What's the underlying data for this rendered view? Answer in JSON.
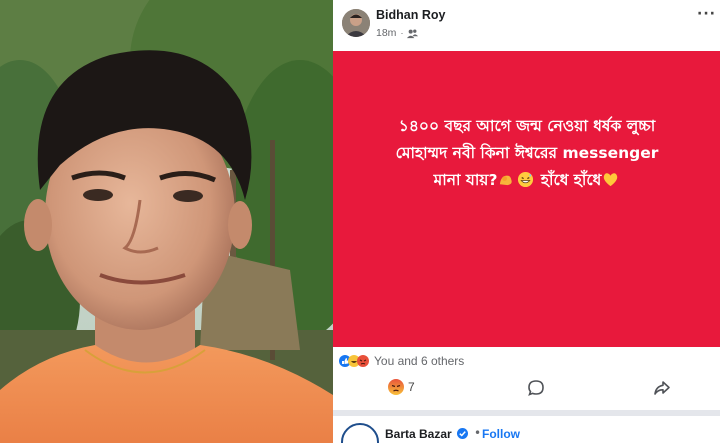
{
  "post": {
    "author": "Bidhan Roy",
    "time": "18m",
    "privacy_icon": "friends-icon",
    "text_lines": [
      "১৪০০ বছর আগে জন্ম নেওয়া ধর্ষক লুচ্চা",
      "মোহাম্মদ নবী কিনা ঈশ্বরের messenger",
      "মানা যায়?",
      "হাঁধে হাঁধে"
    ],
    "background_color": "#e8193c",
    "reactions_summary": "You and 6 others",
    "angry_count": "7"
  },
  "next_post": {
    "page_name": "Barta Bazar",
    "follow_label": "Follow",
    "separator": "•"
  }
}
